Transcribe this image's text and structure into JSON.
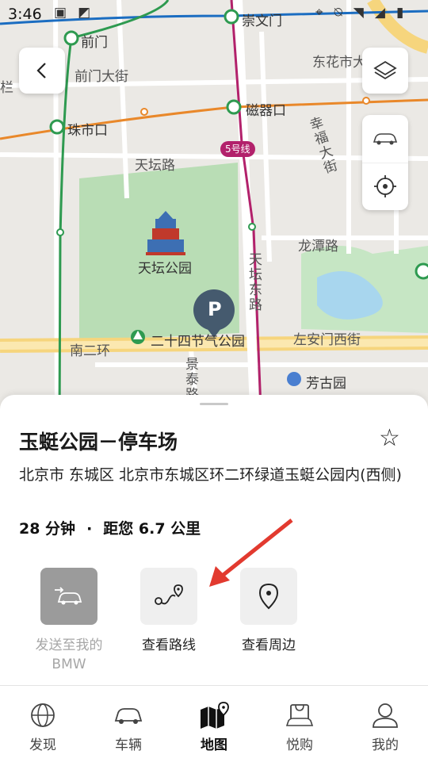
{
  "status_bar": {
    "time": "3:46"
  },
  "map": {
    "labels": {
      "chongwenmen": "崇文门",
      "qianmen": "前门",
      "qianmen_dajie": "前门大街",
      "dongzhimen_partial": "东花市大",
      "left_partial": "栏",
      "ciqikou": "磁器口",
      "zhushikou": "珠市口",
      "xingfu_dajie": "幸福大街",
      "tiantan_lu": "天坛路",
      "line5_badge": "5号线",
      "tiantan_park": "天坛公园",
      "tiantan_donglu": "天坛东路",
      "longtan_lu": "龙潭路",
      "nanerhuan": "南二环",
      "ershisi_jieqi_park": "二十四节气公园",
      "zuoanmen_xijie": "左安门西街",
      "jingtai_lu": "景泰路",
      "fanggu_yuan": "芳古园",
      "parking_marker": "P"
    },
    "colors": {
      "line2": "#1b6dc1",
      "line5": "#b2216b",
      "line7": "#e9882a",
      "line8": "#2e9a50",
      "park_green": "#b9ddb5",
      "marker": "#455a6e"
    }
  },
  "buttons": {
    "back_icon": "chevron-left-icon",
    "layers_icon": "layers-icon",
    "car_icon": "car-icon",
    "locate_icon": "crosshair-icon"
  },
  "place": {
    "title": "玉蜓公园－停车场",
    "address": "北京市 东城区 北京市东城区环二环绿道玉蜓公园内(西侧)",
    "eta_time": "28 分钟",
    "eta_sep": "·",
    "eta_distance": "距您 6.7 公里"
  },
  "actions": [
    {
      "label": "发送至我的 BMW",
      "icon": "send-to-car-icon",
      "enabled": false
    },
    {
      "label": "查看路线",
      "icon": "route-icon",
      "enabled": true
    },
    {
      "label": "查看周边",
      "icon": "location-pin-icon",
      "enabled": true
    }
  ],
  "nav": [
    {
      "label": "发现",
      "icon": "globe-icon",
      "active": false
    },
    {
      "label": "车辆",
      "icon": "car-icon",
      "active": false
    },
    {
      "label": "地图",
      "icon": "map-icon",
      "active": true
    },
    {
      "label": "悦购",
      "icon": "shopping-bag-icon",
      "active": false
    },
    {
      "label": "我的",
      "icon": "person-icon",
      "active": false
    }
  ]
}
